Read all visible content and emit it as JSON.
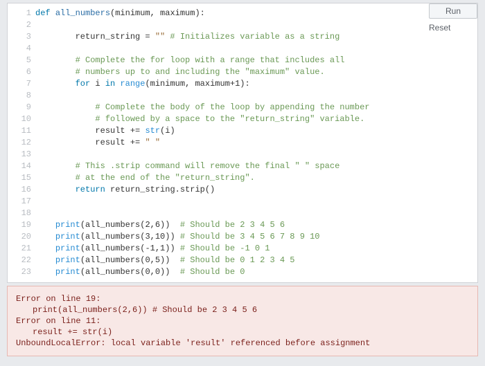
{
  "buttons": {
    "run": "Run",
    "reset": "Reset"
  },
  "lineNumbers": [
    "1",
    "2",
    "3",
    "4",
    "5",
    "6",
    "7",
    "8",
    "9",
    "10",
    "11",
    "12",
    "13",
    "14",
    "15",
    "16",
    "17",
    "18",
    "19",
    "20",
    "21",
    "22",
    "23"
  ],
  "code": {
    "l1": {
      "kw": "def",
      "fn": "all_numbers",
      "sig": "(minimum, maximum):"
    },
    "l3a": "return_string = ",
    "l3s": "\"\"",
    "l3c": " # Initializes variable as a string",
    "l5": "# Complete the for loop with a range that includes all",
    "l6": "# numbers up to and including the \"maximum\" value.",
    "l7": {
      "kw1": "for",
      "id1": " i ",
      "kw2": "in",
      "bi": " range",
      "rest": "(minimum, maximum+1):"
    },
    "l9": "# Complete the body of the loop by appending the number",
    "l10": "# followed by a space to the \"return_string\" variable.",
    "l11a": "result += ",
    "l11b": "str",
    "l11c": "(i)",
    "l12a": "result += ",
    "l12s": "\" \"",
    "l14": "# This .strip command will remove the final \" \" space",
    "l15": "# at the end of the \"return_string\".",
    "l16": {
      "kw": "return",
      "rest": " return_string.strip()"
    },
    "l19a": "print",
    "l19b": "(all_numbers(2,6))  ",
    "l19c": "# Should be 2 3 4 5 6",
    "l20a": "print",
    "l20b": "(all_numbers(3,10)) ",
    "l20c": "# Should be 3 4 5 6 7 8 9 10",
    "l21a": "print",
    "l21b": "(all_numbers(-1,1)) ",
    "l21c": "# Should be -1 0 1",
    "l22a": "print",
    "l22b": "(all_numbers(0,5))  ",
    "l22c": "# Should be 0 1 2 3 4 5",
    "l23a": "print",
    "l23b": "(all_numbers(0,0))  ",
    "l23c": "# Should be 0"
  },
  "error": {
    "line1": "Error on line 19:",
    "line2": "print(all_numbers(2,6))  # Should be 2 3 4 5 6",
    "line3": "Error on line 11:",
    "line4": "result += str(i)",
    "line5": "UnboundLocalError: local variable 'result' referenced before assignment"
  }
}
